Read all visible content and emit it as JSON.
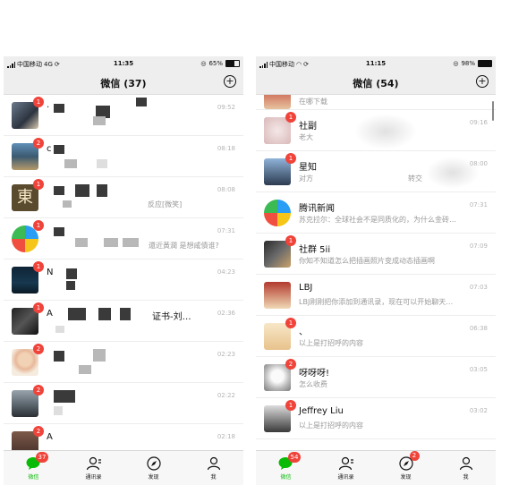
{
  "colors": {
    "badge": "#f0433a",
    "active_tab": "#09bb07",
    "navbar": "#eeeeee"
  },
  "left": {
    "status": {
      "carrier": "中国移动",
      "network": "4G",
      "time": "11:35",
      "battery": "65%",
      "battery_level": 0.65
    },
    "title": "微信 (37)",
    "chats": [
      {
        "badge": "1",
        "name": "·",
        "preview": "",
        "time": "09:52"
      },
      {
        "badge": "2",
        "name": "c",
        "preview": "",
        "time": "08:18"
      },
      {
        "badge": "1",
        "name": "",
        "preview": "反应[微笑]",
        "time": "08:08"
      },
      {
        "badge": "1",
        "name": "",
        "preview": "還近黃潤 是想咸債谁?",
        "time": "07:31"
      },
      {
        "badge": "1",
        "name": "N",
        "preview": "",
        "time": "04:23"
      },
      {
        "badge": "1",
        "name": "A",
        "preview": "证书-刘…",
        "time": "02:36"
      },
      {
        "badge": "2",
        "name": "",
        "preview": "",
        "time": "02:23"
      },
      {
        "badge": "2",
        "name": "",
        "preview": "",
        "time": "02:22"
      },
      {
        "badge": "2",
        "name": "A",
        "preview": "",
        "time": "02:18"
      }
    ],
    "tabs": [
      {
        "label": "微信",
        "icon": "chat-icon",
        "badge": "37"
      },
      {
        "label": "通讯录",
        "icon": "contacts-icon"
      },
      {
        "label": "发现",
        "icon": "compass-icon"
      },
      {
        "label": "我",
        "icon": "person-icon"
      }
    ]
  },
  "right": {
    "status": {
      "carrier": "中国移动",
      "time": "11:15",
      "battery": "98%",
      "battery_level": 0.98
    },
    "title": "微信 (54)",
    "top_partial_preview": "在哪下载",
    "chats": [
      {
        "badge": "1",
        "name": "社副",
        "preview": "老大",
        "time": "09:16"
      },
      {
        "badge": "1",
        "name": "星知",
        "preview": "对方",
        "preview_tail": "转交",
        "time": "08:00"
      },
      {
        "badge": "",
        "name": "腾讯新闻",
        "preview": "苏克拉尔：全球社会不是同质化的，为什么金砖…",
        "time": "07:31"
      },
      {
        "badge": "1",
        "name": "社群 5ii",
        "preview": "你知不知道怎么把插画照片变成动态插画啊",
        "time": "07:09"
      },
      {
        "badge": "",
        "name": "LBJ",
        "preview": "LBJ刚刚把你添加到通讯录，现在可以开始聊天…",
        "time": "07:03"
      },
      {
        "badge": "1",
        "name": "、",
        "preview": "以上是打招呼的内容",
        "time": "06:38"
      },
      {
        "badge": "2",
        "name": "呀呀呀!",
        "preview": "怎么收费",
        "time": "03:05"
      },
      {
        "badge": "1",
        "name": "Jeffrey Liu",
        "preview": "以上是打招呼的内容",
        "time": "03:02"
      }
    ],
    "tabs": [
      {
        "label": "微信",
        "icon": "chat-icon",
        "badge": "54"
      },
      {
        "label": "通讯录",
        "icon": "contacts-icon"
      },
      {
        "label": "发现",
        "icon": "compass-icon",
        "badge": "2"
      },
      {
        "label": "我",
        "icon": "person-icon"
      }
    ]
  }
}
